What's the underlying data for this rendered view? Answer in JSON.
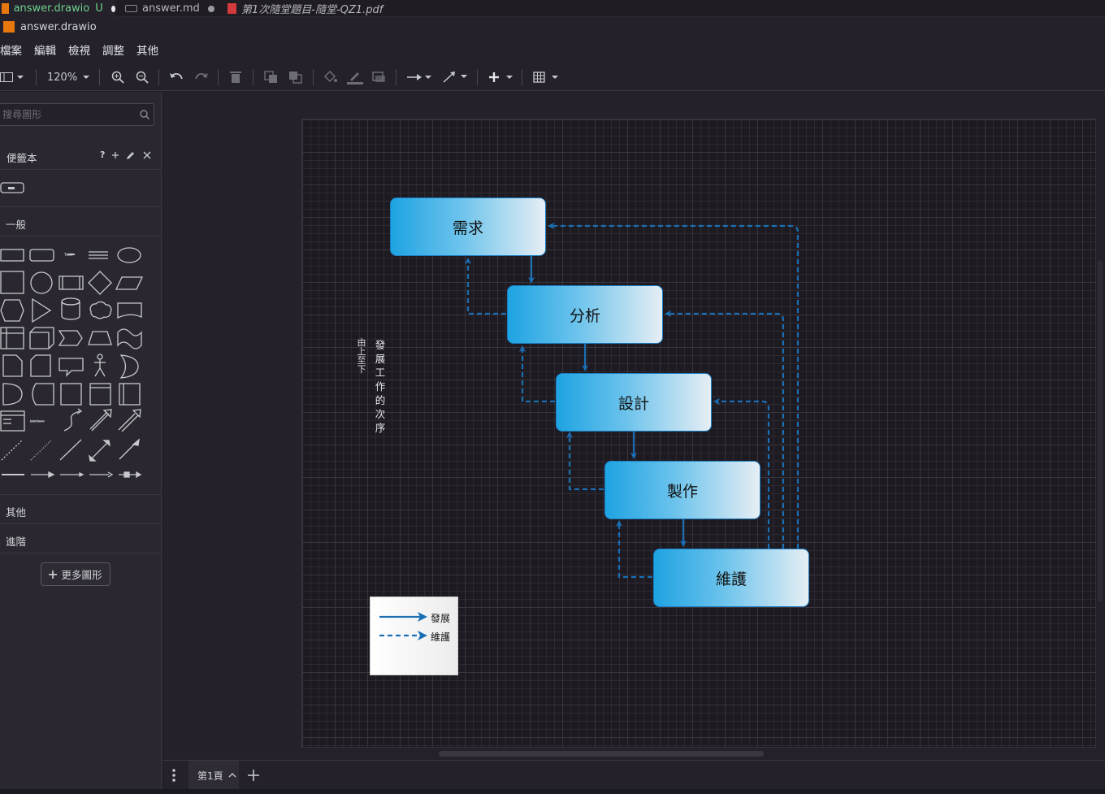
{
  "tabs": [
    {
      "label": "answer.drawio",
      "status": "U"
    },
    {
      "label": "answer.md"
    },
    {
      "label": "第1次隨堂題目-隨堂-QZ1.pdf"
    }
  ],
  "breadcrumb": "answer.drawio",
  "menu": [
    "檔案",
    "編輯",
    "檢視",
    "調整",
    "其他"
  ],
  "toolbar": {
    "zoom": "120%"
  },
  "sidebar": {
    "search_placeholder": "搜尋圖形",
    "scratchpad": "便籤本",
    "scratchpad_help": "?",
    "general": "一般",
    "other": "其他",
    "advanced": "進階",
    "more_shapes": "更多圖形"
  },
  "diagram": {
    "boxes": [
      "需求",
      "分析",
      "設計",
      "製作",
      "維護"
    ],
    "side_label_small": "由上至下",
    "side_label": "發展工作的次序",
    "legend": {
      "solid": "發展",
      "dashed": "維護"
    },
    "colors": {
      "box_border": "#1b7ec4",
      "arrow": "#1a6fb5",
      "box_gradient_start": "#1ea3e2",
      "box_gradient_end": "#e6eef4"
    }
  },
  "pages": {
    "current": "第1頁"
  }
}
